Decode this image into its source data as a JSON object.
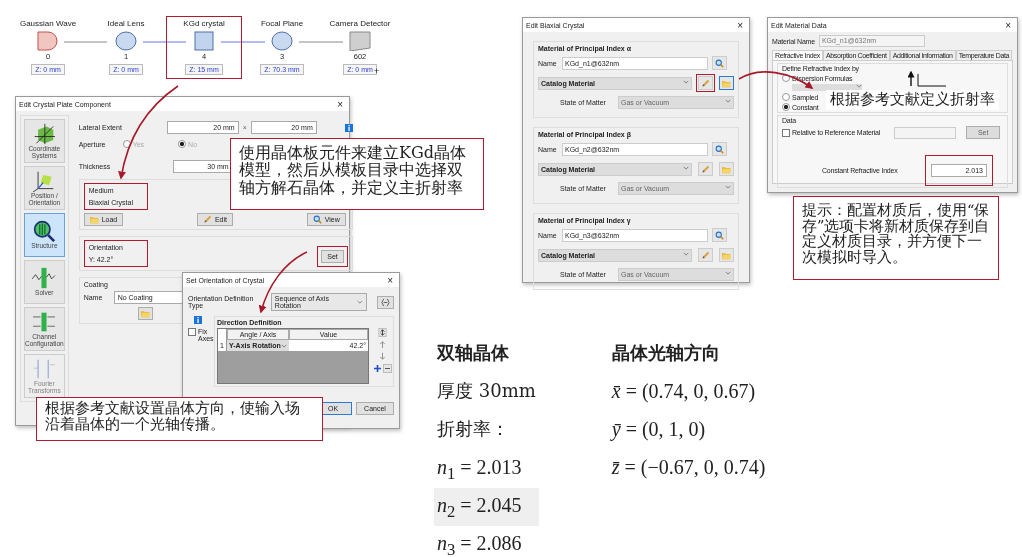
{
  "flow_diagram": {
    "nodes": [
      {
        "label": "Gaussian Wave",
        "kind": "source",
        "index": "0",
        "z": "Z: 0 mm",
        "highlighted": false
      },
      {
        "label": "Ideal Lens",
        "kind": "lens",
        "index": "1",
        "z": "Z: 0 mm",
        "highlighted": false
      },
      {
        "label": "KGd crystal",
        "kind": "plate",
        "index": "4",
        "z": "Z: 15 mm",
        "highlighted": true
      },
      {
        "label": "Focal Plane",
        "kind": "lens",
        "index": "3",
        "z": "Z: 70.3 mm",
        "highlighted": false
      },
      {
        "label": "Camera Detector",
        "kind": "detector",
        "index": "602",
        "z": "Z: 0 mm",
        "highlighted": false
      }
    ],
    "add_mark": "+"
  },
  "crystal_plate_dialog": {
    "title": "Edit Crystal Plate Component",
    "close": "×",
    "sidebar": [
      {
        "label": "Coordinate Systems",
        "selected": false,
        "disabled": false
      },
      {
        "label": "Position / Orientation",
        "selected": false,
        "disabled": false
      },
      {
        "label": "Structure",
        "selected": true,
        "disabled": false
      },
      {
        "label": "Solver",
        "selected": false,
        "disabled": false
      },
      {
        "label": "Channel Configuration",
        "selected": false,
        "disabled": false
      },
      {
        "label": "Fourier Transforms",
        "selected": false,
        "disabled": true
      }
    ],
    "lateral_extent": {
      "label": "Lateral Extent",
      "x": "20 mm",
      "separator": "×",
      "y": "20 mm"
    },
    "aperture": {
      "label": "Aperture",
      "disabled": true,
      "options": [
        {
          "label": "Yes",
          "selected": false
        },
        {
          "label": "No",
          "selected": true
        }
      ]
    },
    "thickness": {
      "label": "Thickness",
      "value": "30 mm"
    },
    "medium": {
      "title": "Medium",
      "value": "Biaxial Crystal",
      "highlighted": true,
      "buttons": [
        {
          "label": "Load",
          "kind": "folder"
        },
        {
          "label": "Edit",
          "kind": "pencil"
        },
        {
          "label": "View",
          "kind": "search"
        }
      ]
    },
    "orientation": {
      "title": "Orientation",
      "value": "Y: 42.2°",
      "highlighted": true,
      "button": "Set",
      "button_highlighted": true
    },
    "coating": {
      "title": "Coating",
      "name_label": "Name",
      "name": "No Coating"
    }
  },
  "orientation_dialog": {
    "title": "Set Orientation of Crystal",
    "close": "×",
    "type_label": "Orientation Definition Type",
    "type": "Sequence of Axis Rotation",
    "fix_axes": {
      "label": "Fix Axes",
      "checked": false
    },
    "group": "Direction Definition",
    "columns": [
      "Angle / Axis",
      "Value"
    ],
    "rows": [
      {
        "index": "1",
        "axis": "Y-Axis Rotation",
        "value": "42.2°"
      }
    ],
    "buttons": [
      {
        "label": "OK",
        "default": true
      },
      {
        "label": "Cancel",
        "default": false
      }
    ]
  },
  "biaxial_dialog": {
    "title": "Edit Biaxial Crystal",
    "close": "×",
    "groups": [
      {
        "title": "Material of Principal Index α",
        "name_label": "Name",
        "name": "KGd_n1@632nm",
        "type": "Catalog Material",
        "state_label": "State of Matter",
        "state": "Gas or Vacuum",
        "edit_highlighted": true,
        "folder_focused": true
      },
      {
        "title": "Material of Principal Index β",
        "name_label": "Name",
        "name": "KGd_n2@632nm",
        "type": "Catalog Material",
        "state_label": "State of Matter",
        "state": "Gas or Vacuum",
        "edit_highlighted": false,
        "folder_focused": false
      },
      {
        "title": "Material of Principal Index γ",
        "name_label": "Name",
        "name": "KGd_n3@632nm",
        "type": "Catalog Material",
        "state_label": "State of Matter",
        "state": "Gas or Vacuum",
        "edit_highlighted": false,
        "folder_focused": false
      }
    ]
  },
  "material_dialog": {
    "title": "Edit Material Data",
    "close": "×",
    "name_label": "Material Name",
    "name": "KGd_n1@632nm",
    "tabs": [
      {
        "label": "Refractive Index",
        "selected": true
      },
      {
        "label": "Absorption Coefficient",
        "selected": false
      },
      {
        "label": "Additional Information",
        "selected": false
      },
      {
        "label": "Temperature Data",
        "selected": false
      }
    ],
    "define_group": "Define Refractive Index by",
    "options": [
      {
        "label": "Dispersion Formulas",
        "selected": false
      },
      {
        "label": "Sampled",
        "selected": false
      },
      {
        "label": "Constant",
        "selected": true
      }
    ],
    "data_group": "Data",
    "relative": {
      "label": "Relative to Reference Material",
      "checked": false
    },
    "set_button": "Set",
    "constant_label": "Constant Refractive Index",
    "constant_value": "2.013",
    "constant_highlighted": true
  },
  "callouts": [
    {
      "text": "使用晶体板元件来建立KGd晶体模型，然后从模板目录中选择双轴方解石晶体，并定义主折射率"
    },
    {
      "text": "根据参考文献设置晶体方向，使输入场沿着晶体的一个光轴传播。"
    },
    {
      "text": "根据参考文献定义折射率"
    },
    {
      "text": "提示：配置材质后，使用“保存”选项卡将新材质保存到自定义材质目录，并方便下一次模拟时导入。"
    }
  ],
  "notes": {
    "left": [
      {
        "text": "双轴晶体",
        "kind": "heading",
        "shaded": false
      },
      {
        "text": "厚度 30mm",
        "kind": "line",
        "shaded": false
      },
      {
        "text": "折射率：",
        "kind": "line",
        "shaded": false
      },
      {
        "text": "*n*$_{1}$ = 2.013",
        "kind": "math",
        "shaded": false
      },
      {
        "text": "*n*$_{2}$ = 2.045",
        "kind": "math",
        "shaded": true
      },
      {
        "text": "*n*$_{3}$ = 2.086",
        "kind": "math",
        "shaded": false
      }
    ],
    "right": [
      {
        "text": "晶体光轴方向",
        "kind": "heading",
        "shaded": false
      },
      {
        "text": "*x̄* = (0.74, 0, 0.67)",
        "kind": "math",
        "shaded": false
      },
      {
        "text": "*ȳ* = (0, 1, 0)",
        "kind": "math",
        "shaded": false
      },
      {
        "text": "*z̄* = (−0.67, 0, 0.74)",
        "kind": "math",
        "shaded": false
      }
    ]
  }
}
